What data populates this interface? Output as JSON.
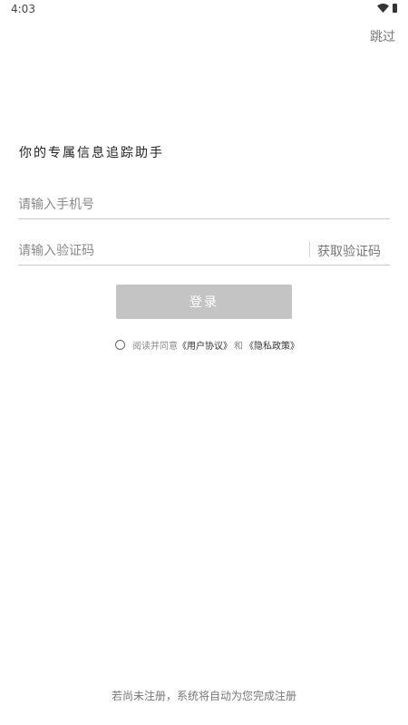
{
  "status_bar": {
    "time": "4:03"
  },
  "header": {
    "skip_label": "跳过"
  },
  "tagline": "你的专属信息追踪助手",
  "form": {
    "phone_placeholder": "请输入手机号",
    "code_placeholder": "请输入验证码",
    "get_code_label": "获取验证码",
    "login_label": "登录"
  },
  "agreement": {
    "prefix": "阅读并同意",
    "user_agreement": "《用户协议》",
    "and": "和",
    "privacy_policy": "《隐私政策》"
  },
  "footer_note": "若尚未注册，系统将自动为您完成注册"
}
